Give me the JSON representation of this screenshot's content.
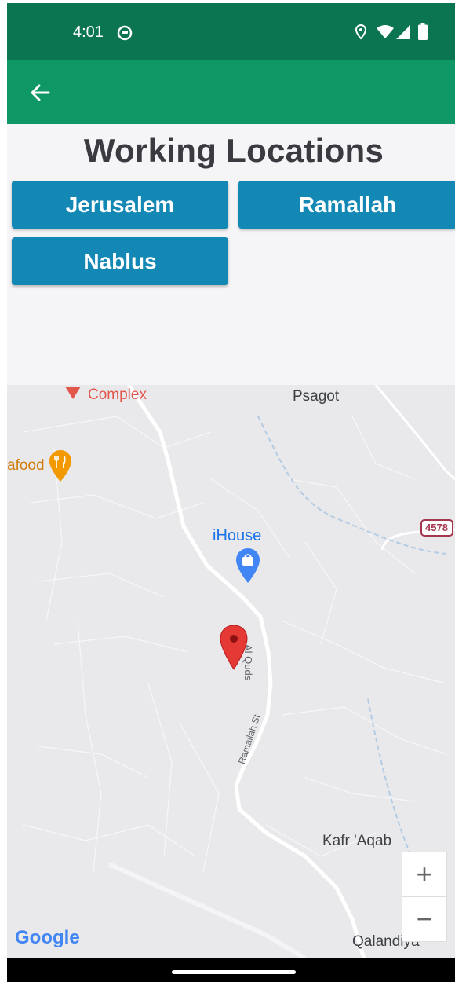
{
  "status": {
    "time": "4:01"
  },
  "header": {
    "back_icon": "arrow-back-icon"
  },
  "page": {
    "title": "Working Locations"
  },
  "locations": [
    "Jerusalem",
    "Ramallah",
    "Nablus"
  ],
  "map": {
    "labels": {
      "complex": "Complex",
      "psagot": "Psagot",
      "seafood": "afood",
      "ihouse": "iHouse",
      "road_4578": "4578",
      "al_quds": "Al Quds",
      "ramallah_st": "Ramallah St",
      "kafr_aqab": "Kafr 'Aqab",
      "qalandiya": "Qalandiya",
      "google": "Google"
    },
    "zoom_in": "+",
    "zoom_out": "−"
  },
  "colors": {
    "statusbar": "#0b7552",
    "appbar": "#0f9766",
    "button": "#1388b5",
    "pin": "#e53935"
  }
}
